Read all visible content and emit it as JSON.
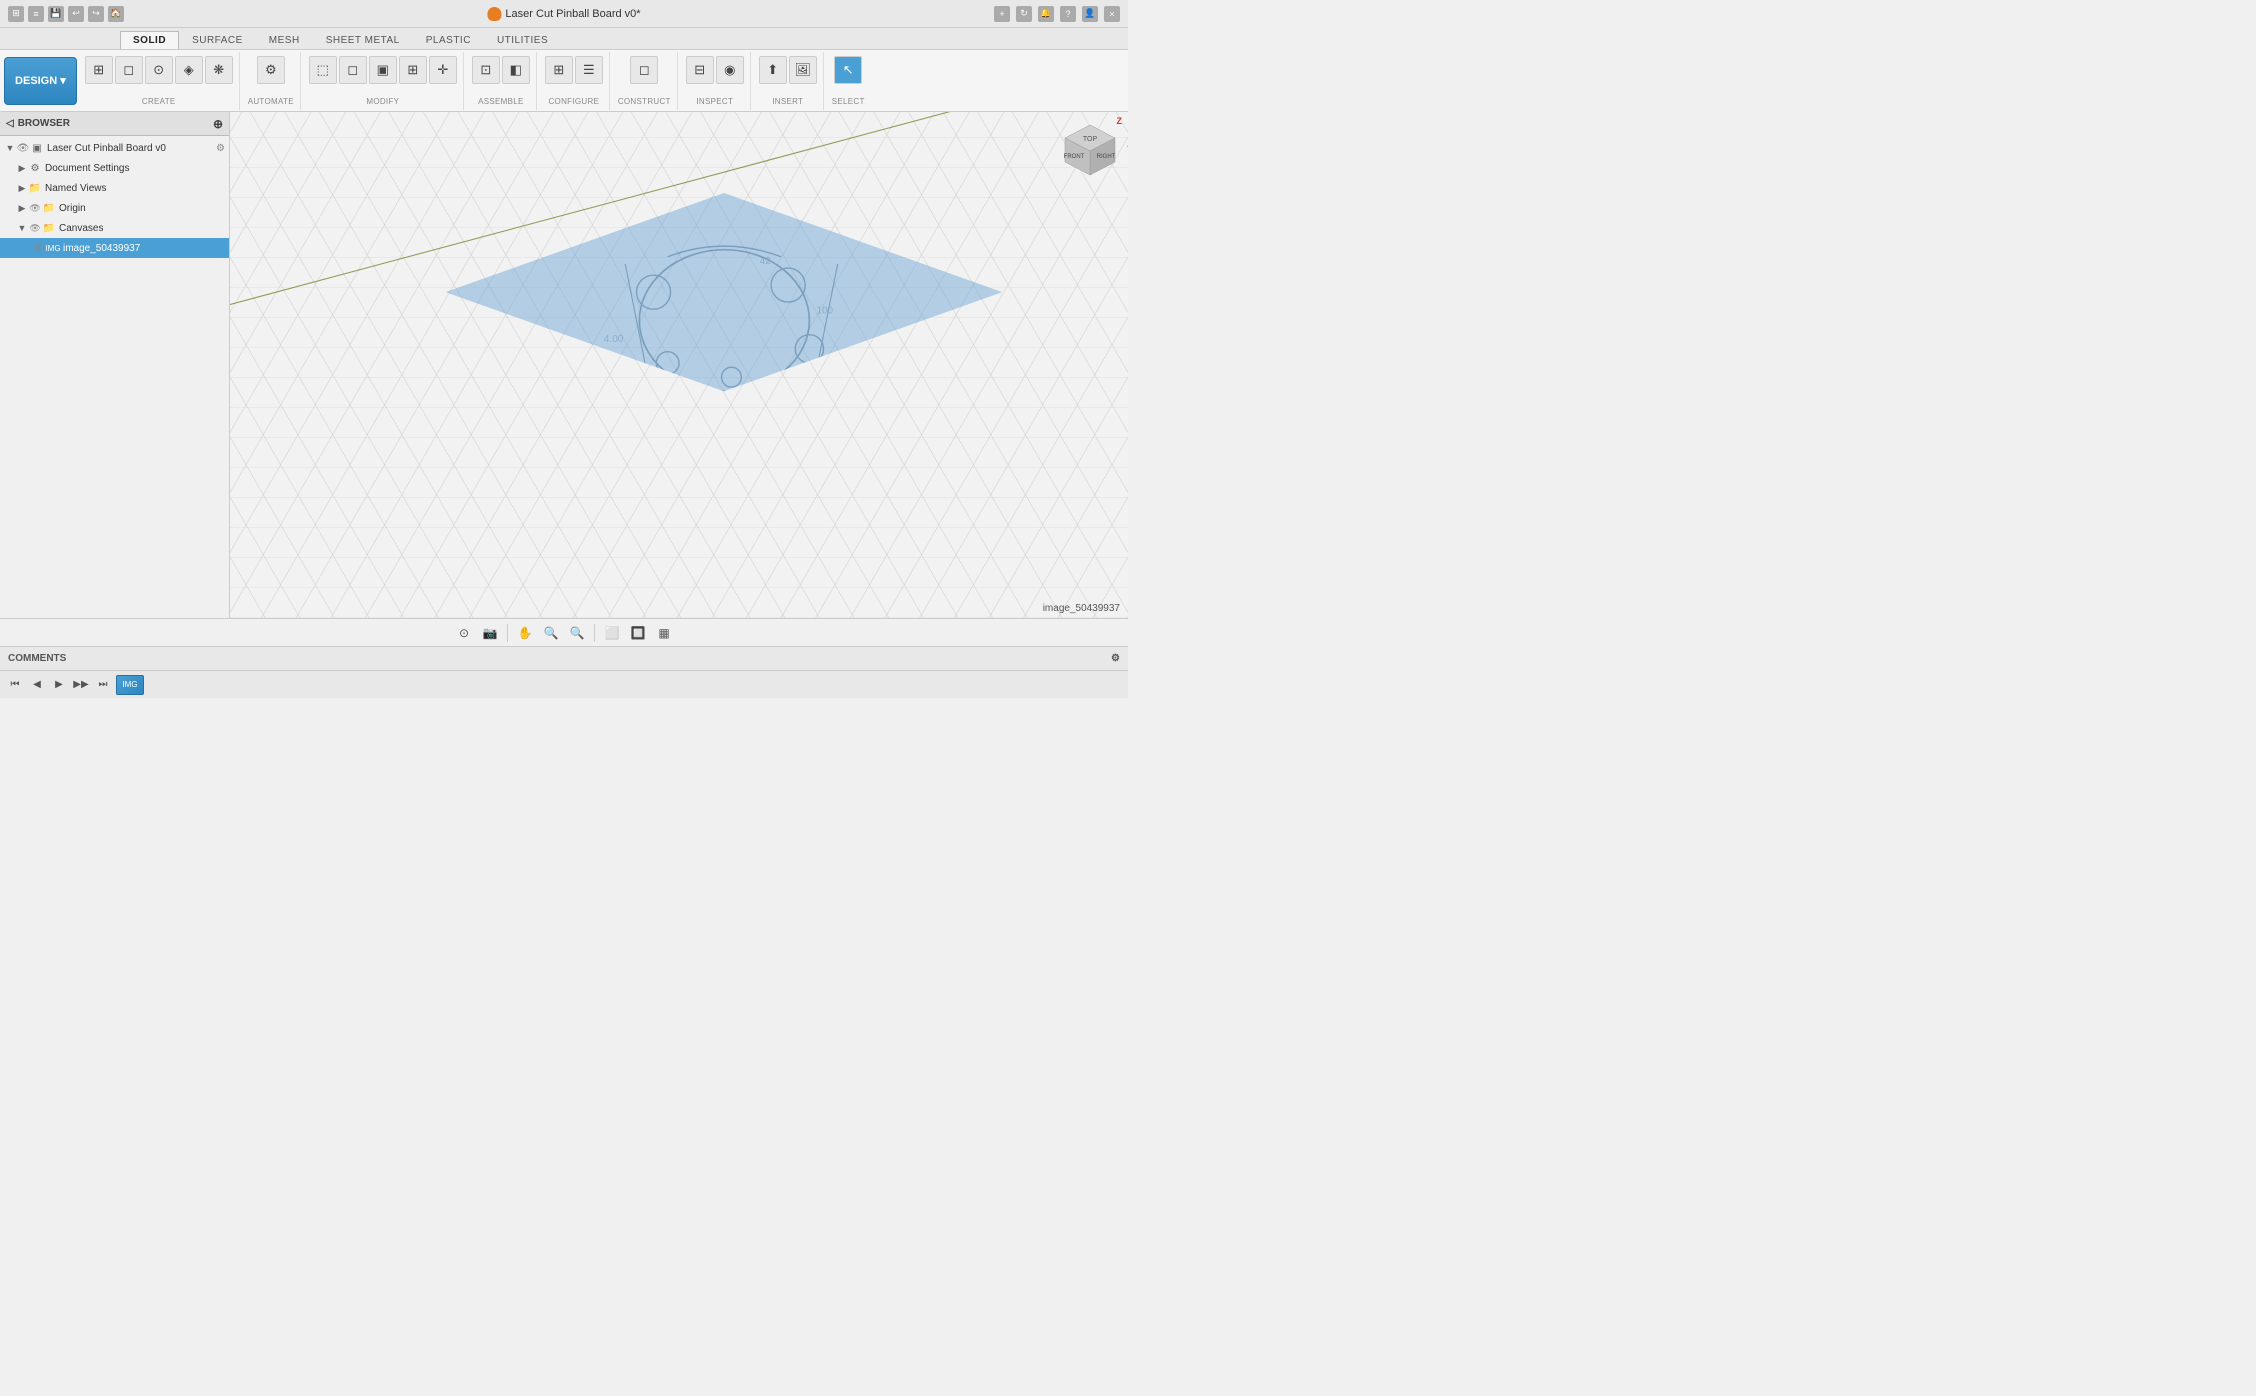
{
  "titleBar": {
    "title": "Laser Cut Pinball Board v0*",
    "flameIcon": "🔶",
    "closeLabel": "×",
    "addTabLabel": "+"
  },
  "tabs": {
    "items": [
      "SOLID",
      "SURFACE",
      "MESH",
      "SHEET METAL",
      "PLASTIC",
      "UTILITIES"
    ],
    "activeIndex": 0
  },
  "toolbar": {
    "designLabel": "DESIGN",
    "groups": [
      {
        "label": "CREATE",
        "hasArrow": true
      },
      {
        "label": "AUTOMATE",
        "hasArrow": true
      },
      {
        "label": "MODIFY",
        "hasArrow": true
      },
      {
        "label": "ASSEMBLE",
        "hasArrow": true
      },
      {
        "label": "CONFIGURE",
        "hasArrow": true
      },
      {
        "label": "CONSTRUCT",
        "hasArrow": true
      },
      {
        "label": "INSPECT",
        "hasArrow": true
      },
      {
        "label": "INSERT",
        "hasArrow": true
      },
      {
        "label": "SELECT",
        "hasArrow": true,
        "active": true
      }
    ]
  },
  "browser": {
    "title": "BROWSER",
    "items": [
      {
        "level": 0,
        "label": "Laser Cut Pinball Board v0",
        "toggle": "▼",
        "showEye": true,
        "icon": "component",
        "hasSettings": true
      },
      {
        "level": 1,
        "label": "Document Settings",
        "toggle": "▶",
        "showEye": false,
        "icon": "gear"
      },
      {
        "level": 1,
        "label": "Named Views",
        "toggle": "▶",
        "showEye": false,
        "icon": "folder"
      },
      {
        "level": 1,
        "label": "Origin",
        "toggle": "▶",
        "showEye": true,
        "icon": "origin"
      },
      {
        "level": 1,
        "label": "Canvases",
        "toggle": "▼",
        "showEye": true,
        "icon": "folder",
        "selected": false
      },
      {
        "level": 2,
        "label": "image_50439937",
        "toggle": "",
        "showEye": true,
        "icon": "image",
        "selected": true
      }
    ]
  },
  "viewport": {
    "canvasStatusLabel": "image_50439937"
  },
  "bottomToolbar": {
    "icons": [
      "⊙",
      "📷",
      "✋",
      "🔍",
      "🔍",
      "⬜",
      "🔲",
      "▦"
    ]
  },
  "commentsBar": {
    "label": "COMMENTS",
    "settingsIcon": "⚙"
  },
  "timeline": {
    "buttons": [
      "⏮",
      "◀",
      "▶",
      "▶▶",
      "⏭"
    ],
    "thumbnailPresent": true
  }
}
